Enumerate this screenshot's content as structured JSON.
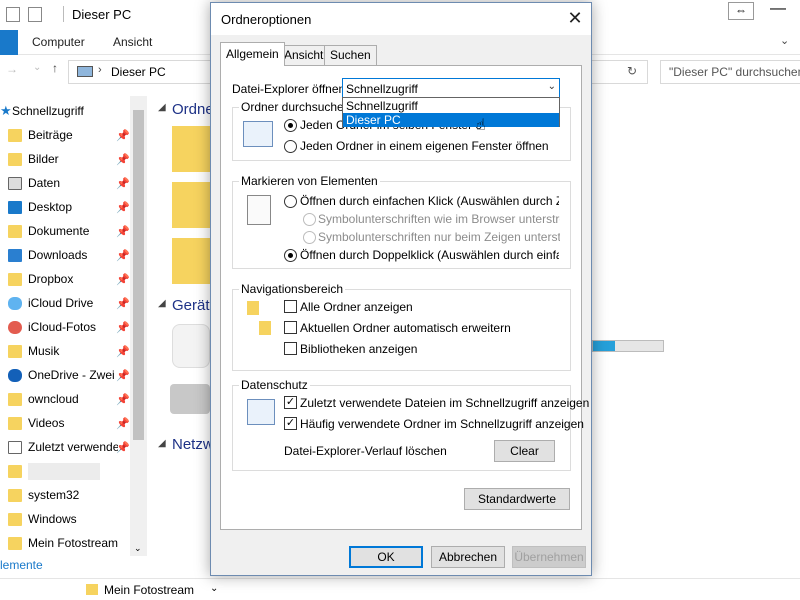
{
  "explorer": {
    "title": "Dieser PC",
    "ribbon_tabs": [
      "Computer",
      "Ansicht"
    ],
    "address_crumb": "Dieser PC",
    "search_placeholder": "\"Dieser PC\" durchsuchen",
    "nav_items": [
      {
        "label": "Schnellzugriff",
        "pinned": false
      },
      {
        "label": "Beiträge",
        "pinned": true
      },
      {
        "label": "Bilder",
        "pinned": true
      },
      {
        "label": "Daten",
        "pinned": true
      },
      {
        "label": "Desktop",
        "pinned": true
      },
      {
        "label": "Dokumente",
        "pinned": true
      },
      {
        "label": "Downloads",
        "pinned": true
      },
      {
        "label": "Dropbox",
        "pinned": true
      },
      {
        "label": "iCloud Drive",
        "pinned": true
      },
      {
        "label": "iCloud-Fotos",
        "pinned": true
      },
      {
        "label": "Musik",
        "pinned": true
      },
      {
        "label": "OneDrive - Zweit",
        "pinned": true
      },
      {
        "label": "owncloud",
        "pinned": true
      },
      {
        "label": "Videos",
        "pinned": true
      },
      {
        "label": "Zuletzt verwende",
        "pinned": true
      },
      {
        "label": "",
        "pinned": false
      },
      {
        "label": "system32",
        "pinned": false
      },
      {
        "label": "Windows",
        "pinned": false
      },
      {
        "label": "Mein Fotostream",
        "pinned": false
      }
    ],
    "section_headings": [
      "Ordne",
      "Geräte",
      "Netzw"
    ],
    "status_text": "lemente",
    "bottom_item": "Mein Fotostream"
  },
  "dialog": {
    "title": "Ordneroptionen",
    "close_icon": "close-icon",
    "tabs": [
      "Allgemein",
      "Ansicht",
      "Suchen"
    ],
    "open_label": "Datei-Explorer öffnen für:",
    "combo_value": "Schnellzugriff",
    "dropdown_options": [
      "Schnellzugriff",
      "Dieser PC"
    ],
    "dropdown_selected": "Dieser PC",
    "browse_group": {
      "title": "Ordner durchsuchen",
      "opt1": "Jeden Ordner im selben Fenster öffnen",
      "opt2": "Jeden Ordner in einem eigenen Fenster öffnen"
    },
    "click_group": {
      "title": "Markieren von Elementen",
      "opt1": "Öffnen durch einfachen Klick (Auswählen durch Zeigen)",
      "opt1a": "Symbolunterschriften wie im Browser unterstreichen",
      "opt1b": "Symbolunterschriften nur beim Zeigen unterstreichen",
      "opt2": "Öffnen durch Doppelklick (Auswählen durch einfachen Klick)"
    },
    "nav_group": {
      "title": "Navigationsbereich",
      "opt1": "Alle Ordner anzeigen",
      "opt2": "Aktuellen Ordner automatisch erweitern",
      "opt3": "Bibliotheken anzeigen"
    },
    "privacy_group": {
      "title": "Datenschutz",
      "opt1": "Zuletzt verwendete Dateien im Schnellzugriff anzeigen",
      "opt2": "Häufig verwendete Ordner im Schnellzugriff anzeigen",
      "history_label": "Datei-Explorer-Verlauf löschen",
      "clear_button": "Clear"
    },
    "defaults_button": "Standardwerte",
    "ok_button": "OK",
    "cancel_button": "Abbrechen",
    "apply_button": "Übernehmen"
  }
}
